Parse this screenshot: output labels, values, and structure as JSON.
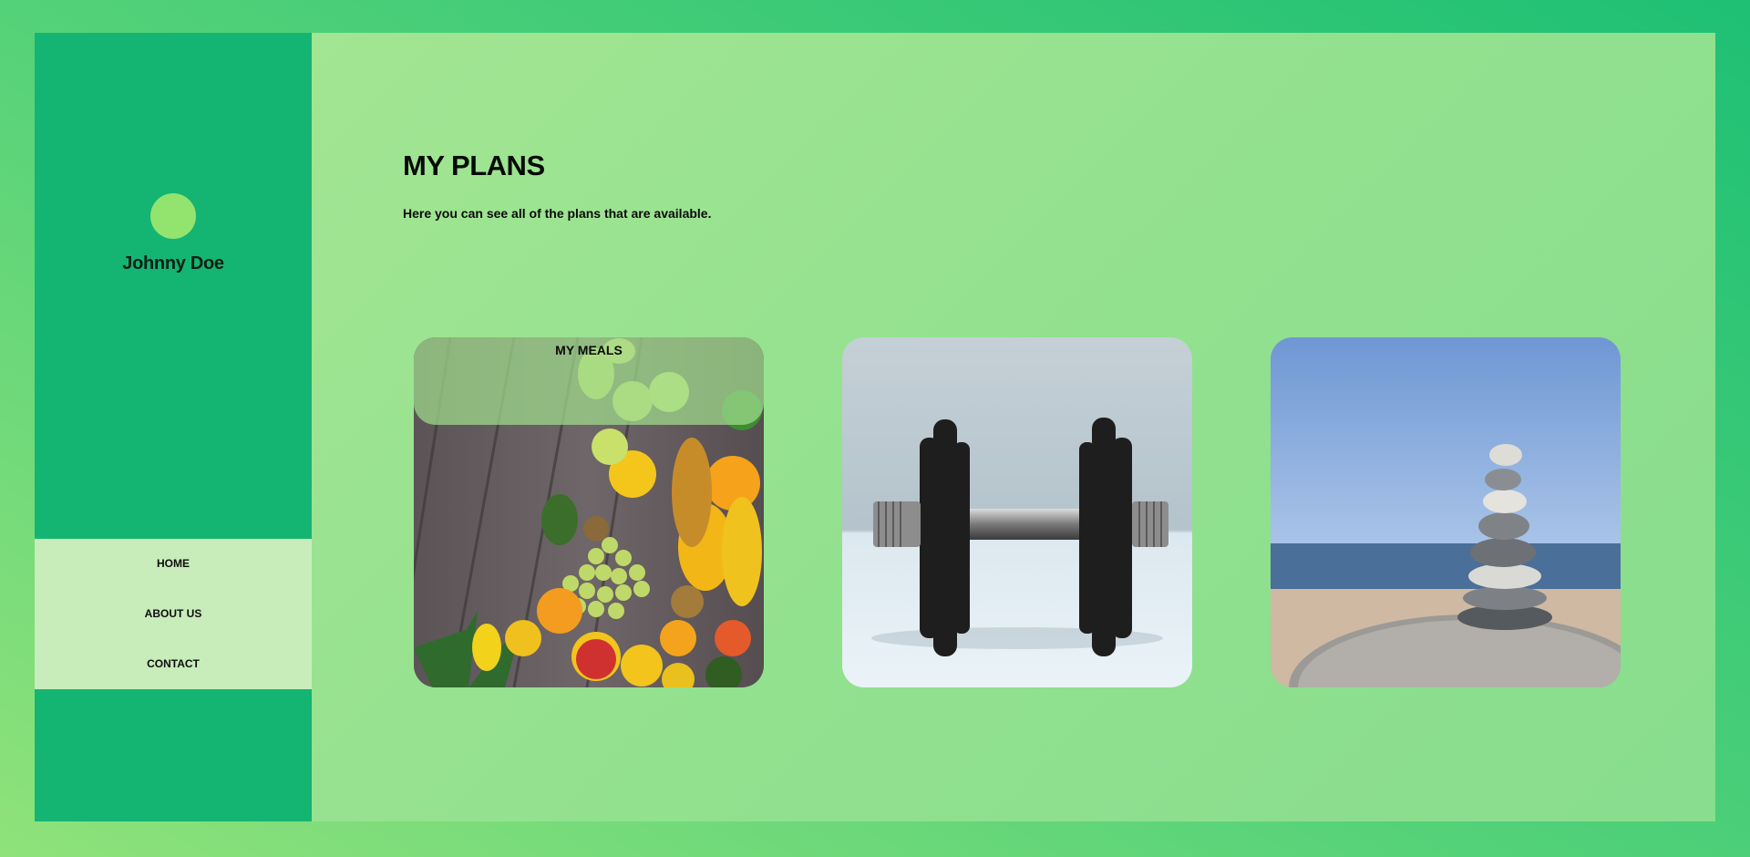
{
  "user": {
    "name": "Johnny Doe"
  },
  "nav": {
    "items": [
      {
        "label": "HOME"
      },
      {
        "label": "ABOUT US"
      },
      {
        "label": "CONTACT"
      }
    ]
  },
  "main": {
    "title": "MY PLANS",
    "subtitle": "Here you can see all of the plans that are available.",
    "cards": [
      {
        "label": "MY MEALS",
        "icon": "fruits-image"
      },
      {
        "label": "",
        "icon": "dumbbell-image"
      },
      {
        "label": "",
        "icon": "stacked-stones-image"
      }
    ]
  },
  "colors": {
    "sidebar": "#14b572",
    "nav_bg": "#c8ecba",
    "avatar": "#93e46e",
    "main_bg": "#92e18f"
  }
}
